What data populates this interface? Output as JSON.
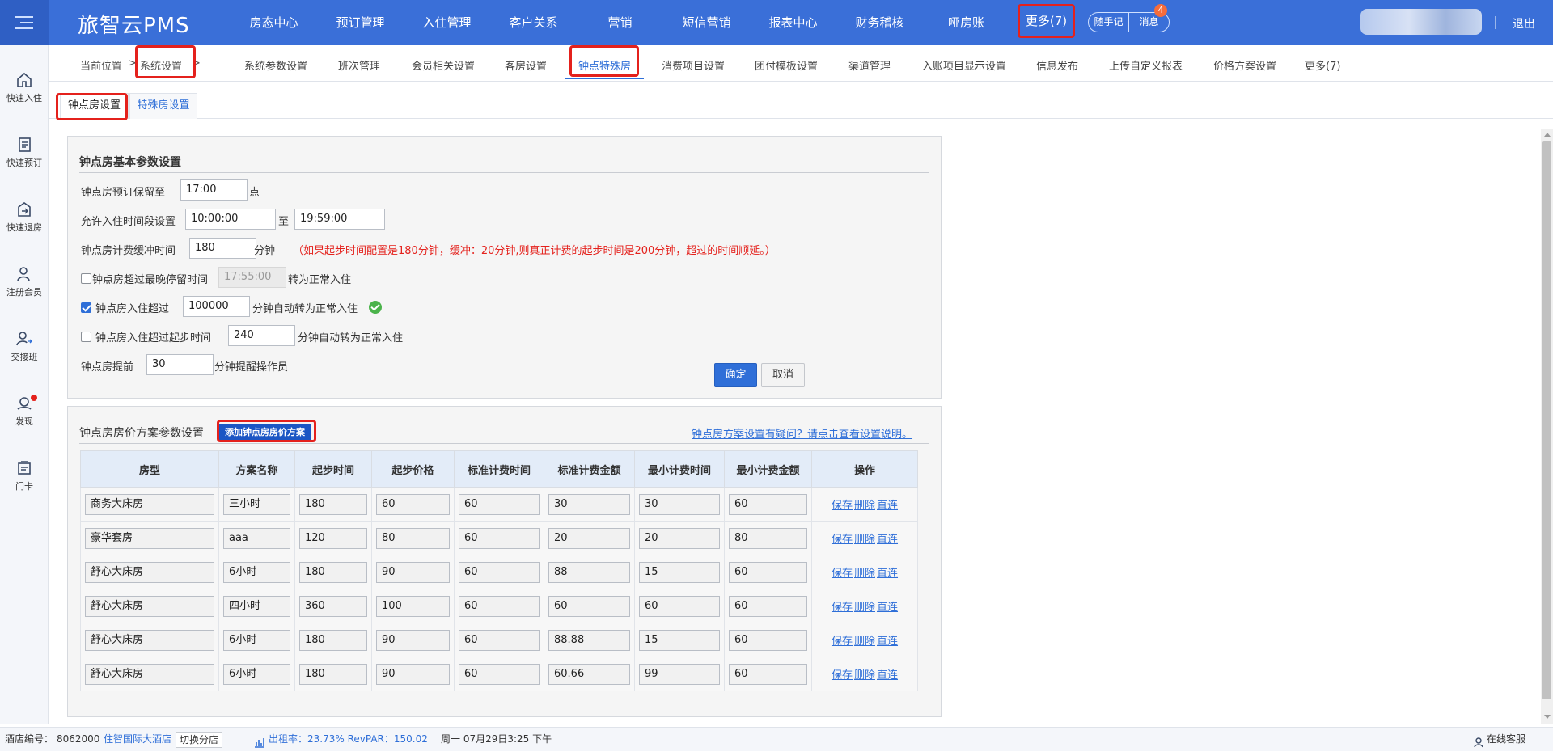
{
  "header": {
    "brand": "旅智云PMS",
    "nav": [
      "房态中心",
      "预订管理",
      "入住管理",
      "客户关系",
      "营销",
      "短信营销",
      "报表中心",
      "财务稽核",
      "哑房账"
    ],
    "more": "更多(7)",
    "notes_label": "随手记",
    "messages_label": "消息",
    "messages_badge": "4",
    "logout": "退出"
  },
  "sidebar": [
    {
      "label": "快速入住",
      "icon": "home-icon"
    },
    {
      "label": "快速预订",
      "icon": "document-icon"
    },
    {
      "label": "快速退房",
      "icon": "checkout-icon"
    },
    {
      "label": "注册会员",
      "icon": "user-add-icon"
    },
    {
      "label": "交接班",
      "icon": "shift-handover-icon"
    },
    {
      "label": "发现",
      "icon": "discover-icon"
    },
    {
      "label": "门卡",
      "icon": "door-card-icon"
    }
  ],
  "breadcrumb": {
    "location_label": "当前位置",
    "separator": ">",
    "current": "系统设置"
  },
  "subtabs": [
    "系统参数设置",
    "班次管理",
    "会员相关设置",
    "客房设置",
    "钟点特殊房",
    "消费项目设置",
    "团付模板设置",
    "渠道管理",
    "入账项目显示设置",
    "信息发布",
    "上传自定义报表",
    "价格方案设置",
    "更多(7)"
  ],
  "page_tabs": [
    "钟点房设置",
    "特殊房设置"
  ],
  "basic": {
    "title": "钟点房基本参数设置",
    "reserve_label": "钟点房预订保留至",
    "reserve_value": "17:00",
    "reserve_unit": "点",
    "window_label": "允许入住时间段设置",
    "window_start": "10:00:00",
    "window_to": "至",
    "window_end": "19:59:00",
    "buffer_label": "钟点房计费缓冲时间",
    "buffer_value": "180",
    "buffer_unit": "分钟",
    "buffer_note": "（如果起步时间配置是180分钟，缓冲：20分钟,则真正计费的起步时间是200分钟，超过的时间顺延。）",
    "latest_label": "钟点房超过最晚停留时间",
    "latest_value": "17:55:00",
    "latest_suffix": "转为正常入住",
    "over_label": "钟点房入住超过",
    "over_value": "100000",
    "over_suffix": "分钟自动转为正常入住",
    "start_label": "钟点房入住超过起步时间",
    "start_value": "240",
    "start_suffix": "分钟自动转为正常入住",
    "remind_label": "钟点房提前",
    "remind_value": "30",
    "remind_suffix": "分钟提醒操作员",
    "confirm": "确定",
    "cancel": "取消"
  },
  "pricing": {
    "title": "钟点房房价方案参数设置",
    "add_button": "添加钟点房房价方案",
    "help_link": "钟点房方案设置有疑问？请点击查看设置说明。",
    "columns": [
      "房型",
      "方案名称",
      "起步时间",
      "起步价格",
      "标准计费时间",
      "标准计费金额",
      "最小计费时间",
      "最小计费金额",
      "操作"
    ],
    "actions": [
      "保存",
      "删除",
      "直连"
    ],
    "rows": [
      [
        "商务大床房",
        "三小时",
        "180",
        "60",
        "60",
        "30",
        "30",
        "60"
      ],
      [
        "豪华套房",
        "aaa",
        "120",
        "80",
        "60",
        "20",
        "20",
        "80"
      ],
      [
        "舒心大床房",
        "6小时",
        "180",
        "90",
        "60",
        "88",
        "15",
        "60"
      ],
      [
        "舒心大床房",
        "四小时",
        "360",
        "100",
        "60",
        "60",
        "60",
        "60"
      ],
      [
        "舒心大床房",
        "6小时",
        "180",
        "90",
        "60",
        "88.88",
        "15",
        "60"
      ],
      [
        "舒心大床房",
        "6小时",
        "180",
        "90",
        "60",
        "60.66",
        "99",
        "60"
      ]
    ]
  },
  "footer": {
    "hotel_no_label": "酒店编号：",
    "hotel_no": "8062000",
    "hotel_name": "住智国际大酒店",
    "switch": "切换分店",
    "occupancy": "出租率：23.73% RevPAR：150.02",
    "datetime": "周一 07月29日3:25 下午",
    "service": "在线客服"
  }
}
